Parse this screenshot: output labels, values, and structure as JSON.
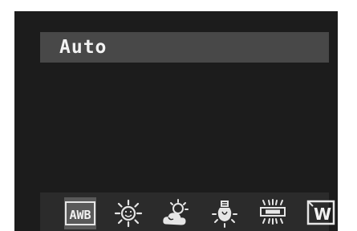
{
  "screen": {
    "mode_label": "Auto"
  },
  "white_balance": {
    "selected": "auto-white-balance",
    "options": [
      {
        "icon": "auto-white-balance-icon",
        "text": "AWB"
      },
      {
        "icon": "daylight-sun-icon"
      },
      {
        "icon": "cloudy-icon"
      },
      {
        "icon": "tungsten-bulb-icon"
      },
      {
        "icon": "fluorescent-icon"
      },
      {
        "icon": "custom-white-icon",
        "text": "W"
      }
    ]
  }
}
